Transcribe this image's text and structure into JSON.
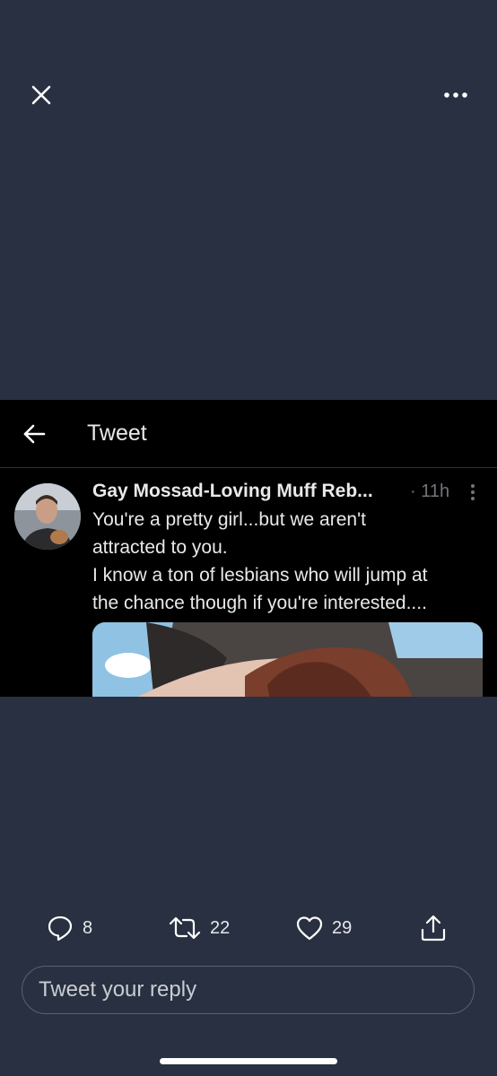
{
  "viewer": {
    "close_icon": "close-icon",
    "more_icon": "more-horizontal-icon"
  },
  "embedded": {
    "header": {
      "back_icon": "arrow-left-icon",
      "title": "Tweet"
    },
    "tweet": {
      "author_name": "Gay Mossad-Loving Muff Reb...",
      "time": "· 11h",
      "text_lines": [
        "You're a pretty girl...but we aren't",
        "attracted to you.",
        "I know a ton of lesbians who will jump at",
        "the chance though if you're interested...."
      ],
      "more_icon": "more-vertical-icon"
    }
  },
  "actions": {
    "reply_count": "8",
    "retweet_count": "22",
    "like_count": "29"
  },
  "reply_box": {
    "placeholder": "Tweet your reply"
  },
  "colors": {
    "background": "#283041",
    "embedded_background": "#000000",
    "text": "#e7e9ea",
    "muted": "#71767b"
  }
}
